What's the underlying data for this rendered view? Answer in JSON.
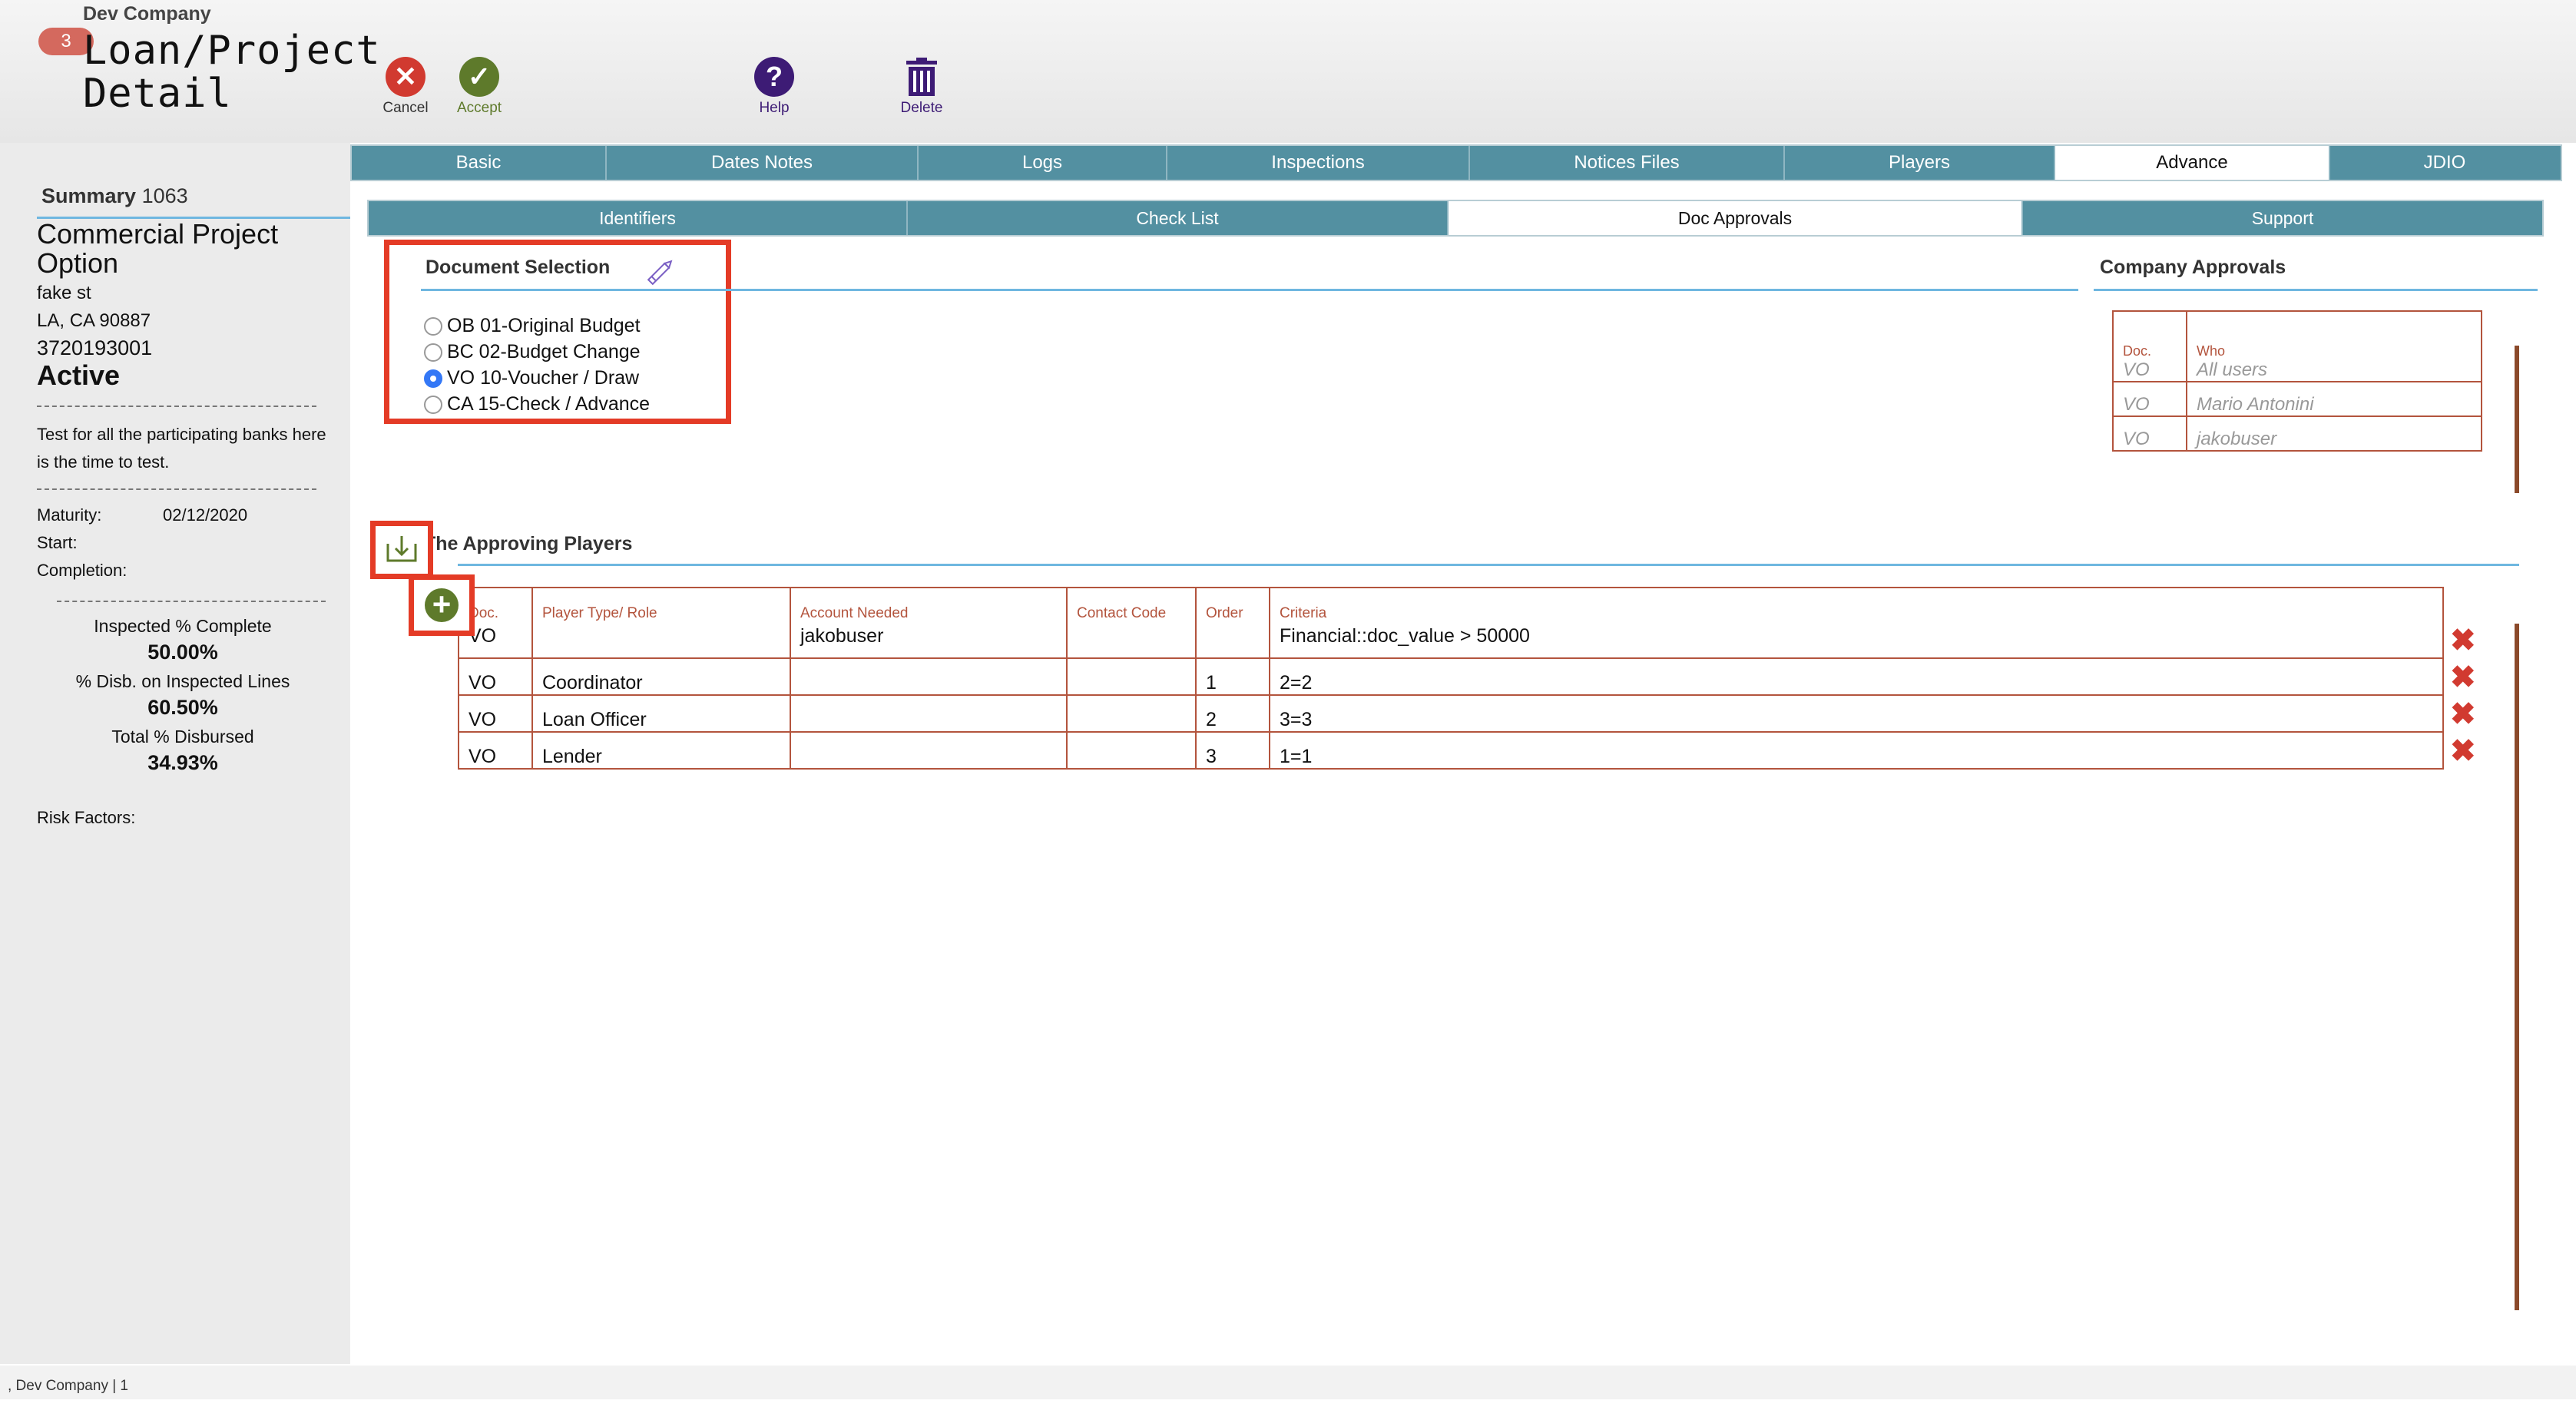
{
  "header": {
    "company": "Dev Company",
    "badge_count": "3",
    "title": "Loan/Project Detail",
    "toolbar": {
      "cancel": "Cancel",
      "accept": "Accept",
      "help": "Help",
      "delete": "Delete"
    }
  },
  "sidebar": {
    "summary_label": "Summary",
    "summary_id": "1063",
    "project_name": "Commercial Project Option",
    "address1": "fake st",
    "address2": "LA, CA  90887",
    "account": "3720193001",
    "status": "Active",
    "note": "Test for all the participating banks here is the time to test.",
    "maturity_label": "Maturity:",
    "maturity_value": "02/12/2020",
    "start_label": "Start:",
    "completion_label": "Completion:",
    "inspected_label": "Inspected % Complete",
    "inspected_value": "50.00%",
    "disb_label": "% Disb. on Inspected Lines",
    "disb_value": "60.50%",
    "total_label": "Total % Disbursed",
    "total_value": "34.93%",
    "risk_label": "Risk Factors:"
  },
  "tabs": [
    "Basic",
    "Dates Notes",
    "Logs",
    "Inspections",
    "Notices Files",
    "Players",
    "Advance",
    "JDIO"
  ],
  "active_tab": "Advance",
  "subtabs": [
    "Identifiers",
    "Check List",
    "Doc Approvals",
    "Support"
  ],
  "active_subtab": "Doc Approvals",
  "document_selection": {
    "title": "Document Selection",
    "options": [
      {
        "label": "OB 01-Original Budget",
        "checked": false
      },
      {
        "label": "BC 02-Budget Change",
        "checked": false
      },
      {
        "label": "VO 10-Voucher / Draw",
        "checked": true
      },
      {
        "label": "CA 15-Check / Advance",
        "checked": false
      }
    ]
  },
  "company_approvals": {
    "title": "Company Approvals",
    "headers": {
      "doc": "Doc.",
      "who": "Who"
    },
    "rows": [
      {
        "doc": "VO",
        "who": "All users"
      },
      {
        "doc": "VO",
        "who": "Mario Antonini"
      },
      {
        "doc": "VO",
        "who": "jakobuser"
      }
    ]
  },
  "approving_players": {
    "title": "The Approving Players",
    "headers": {
      "doc": "Doc.",
      "role": "Player Type/ Role",
      "account": "Account Needed",
      "contact": "Contact Code",
      "order": "Order",
      "criteria": "Criteria"
    },
    "header_row": {
      "doc": "VO",
      "role": "",
      "account": "jakobuser",
      "contact": "",
      "order": "",
      "criteria": "Financial::doc_value > 50000"
    },
    "rows": [
      {
        "doc": "VO",
        "role": "Coordinator",
        "account": "",
        "contact": "",
        "order": "1",
        "criteria": "2=2"
      },
      {
        "doc": "VO",
        "role": "Loan Officer",
        "account": "",
        "contact": "",
        "order": "2",
        "criteria": "3=3"
      },
      {
        "doc": "VO",
        "role": "Lender",
        "account": "",
        "contact": "",
        "order": "3",
        "criteria": "1=1"
      }
    ]
  },
  "footer": {
    "text": ", Dev Company | 1"
  },
  "colors": {
    "tab_bg": "#5390a1",
    "highlight_box": "#e43b26",
    "table_border": "#b3543d",
    "rule_blue": "#6fb7e0",
    "delete_red": "#d13a30",
    "accept_green": "#5e7a2b",
    "help_purple": "#3d1b75"
  },
  "icons": [
    "cancel-icon",
    "accept-icon",
    "help-icon",
    "trash-icon",
    "pencil-icon",
    "import-icon",
    "add-icon",
    "delete-x-icon"
  ]
}
